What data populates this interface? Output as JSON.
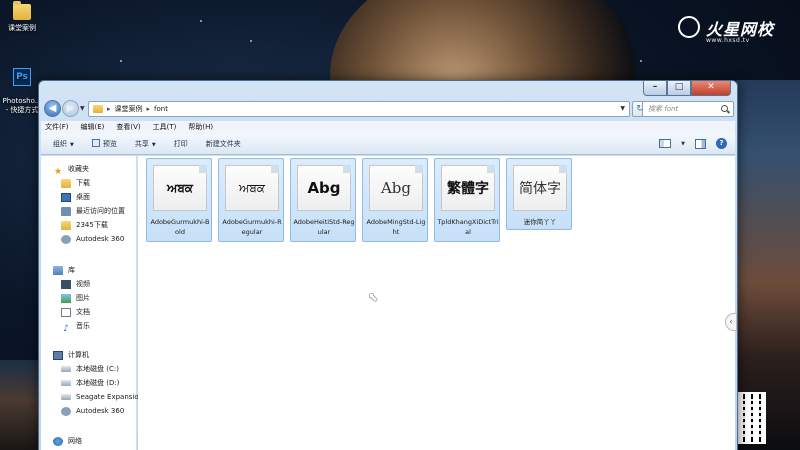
{
  "desktop": {
    "icons": [
      {
        "label": "课堂案例"
      },
      {
        "label": "Photosho...\n- 快捷方式"
      }
    ]
  },
  "watermark": {
    "text": "火星网校",
    "url": "www.hxsd.tv"
  },
  "window": {
    "caption_buttons": {
      "minimize": "–",
      "maximize": "□",
      "close": "✕"
    },
    "address": {
      "segments": [
        "课堂案例",
        "font"
      ],
      "separator": "▸"
    },
    "search": {
      "placeholder": "搜索 font"
    },
    "menu": [
      "文件(F)",
      "编辑(E)",
      "查看(V)",
      "工具(T)",
      "帮助(H)"
    ],
    "toolbar": {
      "organize": "组织",
      "preview": "预览",
      "share": "共享",
      "print": "打印",
      "new_folder": "新建文件夹"
    },
    "nav": {
      "favorites": {
        "label": "收藏夹",
        "items": [
          "下载",
          "桌面",
          "最近访问的位置",
          "2345下载",
          "Autodesk 360"
        ]
      },
      "libraries": {
        "label": "库",
        "items": [
          "视频",
          "图片",
          "文档",
          "音乐"
        ]
      },
      "computer": {
        "label": "计算机",
        "items": [
          "本地磁盘 (C:)",
          "本地磁盘 (D:)",
          "Seagate Expansio",
          "Autodesk 360"
        ]
      },
      "network": {
        "label": "网络"
      }
    },
    "files": [
      {
        "sample": "ਅਬਕ",
        "name": "AdobeGurmukhi-Bold"
      },
      {
        "sample": "ਅਬਕ",
        "name": "AdobeGurmukhi-Regular"
      },
      {
        "sample": "Abg",
        "name": "AdobeHeitiStd-Regular"
      },
      {
        "sample": "Abg",
        "name": "AdobeMingStd-Light"
      },
      {
        "sample": "繁體字",
        "name": "TpldKhangXiDictTrial"
      },
      {
        "sample": "简体字",
        "name": "迷你简丫丫"
      }
    ]
  },
  "colors": {
    "selection": "#c6e0f8",
    "window_frame": "#bcd3ea",
    "accent": "#2f6cb7"
  }
}
